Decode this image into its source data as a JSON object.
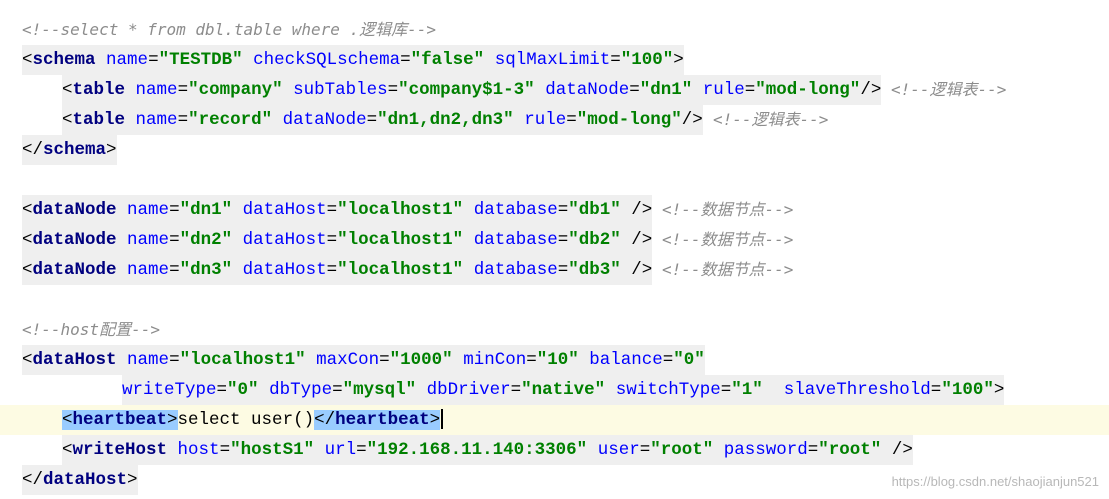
{
  "lines": [
    {
      "id": "l1",
      "tokens": [
        {
          "t": "<!--select * from dbl.table where .逻辑库-->",
          "c": "cmt"
        }
      ]
    },
    {
      "id": "l2",
      "tokens": [
        {
          "t": "<",
          "c": "br"
        },
        {
          "t": "schema",
          "c": "tag"
        },
        {
          "t": " "
        },
        {
          "t": "name",
          "c": "attr"
        },
        {
          "t": "=",
          "c": "txt"
        },
        {
          "t": "\"TESTDB\"",
          "c": "val"
        },
        {
          "t": " "
        },
        {
          "t": "checkSQLschema",
          "c": "attr"
        },
        {
          "t": "=",
          "c": "txt"
        },
        {
          "t": "\"false\"",
          "c": "val"
        },
        {
          "t": " "
        },
        {
          "t": "sqlMaxLimit",
          "c": "attr"
        },
        {
          "t": "=",
          "c": "txt"
        },
        {
          "t": "\"100\"",
          "c": "val"
        },
        {
          "t": ">",
          "c": "br"
        }
      ]
    },
    {
      "id": "l3",
      "tokens": [
        {
          "t": "<",
          "c": "br"
        },
        {
          "t": "table",
          "c": "tag"
        },
        {
          "t": " "
        },
        {
          "t": "name",
          "c": "attr"
        },
        {
          "t": "=",
          "c": "txt"
        },
        {
          "t": "\"company\"",
          "c": "val"
        },
        {
          "t": " "
        },
        {
          "t": "subTables",
          "c": "attr"
        },
        {
          "t": "=",
          "c": "txt"
        },
        {
          "t": "\"company$1-3\"",
          "c": "val"
        },
        {
          "t": " "
        },
        {
          "t": "dataNode",
          "c": "attr"
        },
        {
          "t": "=",
          "c": "txt"
        },
        {
          "t": "\"dn1\"",
          "c": "val"
        },
        {
          "t": " "
        },
        {
          "t": "rule",
          "c": "attr"
        },
        {
          "t": "=",
          "c": "txt"
        },
        {
          "t": "\"mod-long\"",
          "c": "val"
        },
        {
          "t": "/>",
          "c": "br"
        }
      ],
      "comment": "<!--逻辑表-->"
    },
    {
      "id": "l4",
      "tokens": [
        {
          "t": "<",
          "c": "br"
        },
        {
          "t": "table",
          "c": "tag"
        },
        {
          "t": " "
        },
        {
          "t": "name",
          "c": "attr"
        },
        {
          "t": "=",
          "c": "txt"
        },
        {
          "t": "\"record\"",
          "c": "val"
        },
        {
          "t": " "
        },
        {
          "t": "dataNode",
          "c": "attr"
        },
        {
          "t": "=",
          "c": "txt"
        },
        {
          "t": "\"dn1,dn2,dn3\"",
          "c": "val"
        },
        {
          "t": " "
        },
        {
          "t": "rule",
          "c": "attr"
        },
        {
          "t": "=",
          "c": "txt"
        },
        {
          "t": "\"mod-long\"",
          "c": "val"
        },
        {
          "t": "/>",
          "c": "br"
        }
      ],
      "comment": "<!--逻辑表-->"
    },
    {
      "id": "l5",
      "tokens": [
        {
          "t": "</",
          "c": "br"
        },
        {
          "t": "schema",
          "c": "tag"
        },
        {
          "t": ">",
          "c": "br"
        }
      ]
    },
    {
      "id": "l6",
      "tokens": []
    },
    {
      "id": "l7",
      "tokens": [
        {
          "t": "<",
          "c": "br"
        },
        {
          "t": "dataNode",
          "c": "tag"
        },
        {
          "t": " "
        },
        {
          "t": "name",
          "c": "attr"
        },
        {
          "t": "=",
          "c": "txt"
        },
        {
          "t": "\"dn1\"",
          "c": "val"
        },
        {
          "t": " "
        },
        {
          "t": "dataHost",
          "c": "attr"
        },
        {
          "t": "=",
          "c": "txt"
        },
        {
          "t": "\"localhost1\"",
          "c": "val"
        },
        {
          "t": " "
        },
        {
          "t": "database",
          "c": "attr"
        },
        {
          "t": "=",
          "c": "txt"
        },
        {
          "t": "\"db1\"",
          "c": "val"
        },
        {
          "t": " "
        },
        {
          "t": "/>",
          "c": "br"
        }
      ],
      "comment": "<!--数据节点-->"
    },
    {
      "id": "l8",
      "tokens": [
        {
          "t": "<",
          "c": "br"
        },
        {
          "t": "dataNode",
          "c": "tag"
        },
        {
          "t": " "
        },
        {
          "t": "name",
          "c": "attr"
        },
        {
          "t": "=",
          "c": "txt"
        },
        {
          "t": "\"dn2\"",
          "c": "val"
        },
        {
          "t": " "
        },
        {
          "t": "dataHost",
          "c": "attr"
        },
        {
          "t": "=",
          "c": "txt"
        },
        {
          "t": "\"localhost1\"",
          "c": "val"
        },
        {
          "t": " "
        },
        {
          "t": "database",
          "c": "attr"
        },
        {
          "t": "=",
          "c": "txt"
        },
        {
          "t": "\"db2\"",
          "c": "val"
        },
        {
          "t": " "
        },
        {
          "t": "/>",
          "c": "br"
        }
      ],
      "comment": "<!--数据节点-->"
    },
    {
      "id": "l9",
      "tokens": [
        {
          "t": "<",
          "c": "br"
        },
        {
          "t": "dataNode",
          "c": "tag"
        },
        {
          "t": " "
        },
        {
          "t": "name",
          "c": "attr"
        },
        {
          "t": "=",
          "c": "txt"
        },
        {
          "t": "\"dn3\"",
          "c": "val"
        },
        {
          "t": " "
        },
        {
          "t": "dataHost",
          "c": "attr"
        },
        {
          "t": "=",
          "c": "txt"
        },
        {
          "t": "\"localhost1\"",
          "c": "val"
        },
        {
          "t": " "
        },
        {
          "t": "database",
          "c": "attr"
        },
        {
          "t": "=",
          "c": "txt"
        },
        {
          "t": "\"db3\"",
          "c": "val"
        },
        {
          "t": " "
        },
        {
          "t": "/>",
          "c": "br"
        }
      ],
      "comment": "<!--数据节点-->"
    },
    {
      "id": "l10",
      "tokens": []
    },
    {
      "id": "l11",
      "tokens": [
        {
          "t": "<!--host配置-->",
          "c": "cmt"
        }
      ]
    },
    {
      "id": "l12",
      "tokens": [
        {
          "t": "<",
          "c": "br"
        },
        {
          "t": "dataHost",
          "c": "tag"
        },
        {
          "t": " "
        },
        {
          "t": "name",
          "c": "attr"
        },
        {
          "t": "=",
          "c": "txt"
        },
        {
          "t": "\"localhost1\"",
          "c": "val"
        },
        {
          "t": " "
        },
        {
          "t": "maxCon",
          "c": "attr"
        },
        {
          "t": "=",
          "c": "txt"
        },
        {
          "t": "\"1000\"",
          "c": "val"
        },
        {
          "t": " "
        },
        {
          "t": "minCon",
          "c": "attr"
        },
        {
          "t": "=",
          "c": "txt"
        },
        {
          "t": "\"10\"",
          "c": "val"
        },
        {
          "t": " "
        },
        {
          "t": "balance",
          "c": "attr"
        },
        {
          "t": "=",
          "c": "txt"
        },
        {
          "t": "\"0\"",
          "c": "val"
        }
      ]
    },
    {
      "id": "l13",
      "tokens": [
        {
          "t": "writeType",
          "c": "attr"
        },
        {
          "t": "=",
          "c": "txt"
        },
        {
          "t": "\"0\"",
          "c": "val"
        },
        {
          "t": " "
        },
        {
          "t": "dbType",
          "c": "attr"
        },
        {
          "t": "=",
          "c": "txt"
        },
        {
          "t": "\"mysql\"",
          "c": "val"
        },
        {
          "t": " "
        },
        {
          "t": "dbDriver",
          "c": "attr"
        },
        {
          "t": "=",
          "c": "txt"
        },
        {
          "t": "\"native\"",
          "c": "val"
        },
        {
          "t": " "
        },
        {
          "t": "switchType",
          "c": "attr"
        },
        {
          "t": "=",
          "c": "txt"
        },
        {
          "t": "\"1\"",
          "c": "val"
        },
        {
          "t": "  "
        },
        {
          "t": "slaveThreshold",
          "c": "attr"
        },
        {
          "t": "=",
          "c": "txt"
        },
        {
          "t": "\"100\"",
          "c": "val"
        },
        {
          "t": ">",
          "c": "br"
        }
      ]
    },
    {
      "id": "l14",
      "current": true,
      "tokens": [
        {
          "t": "<",
          "c": "br",
          "m": 1
        },
        {
          "t": "heartbeat",
          "c": "tag",
          "m": 1
        },
        {
          "t": ">",
          "c": "br",
          "m": 1
        },
        {
          "t": "select user()",
          "c": "txt"
        },
        {
          "t": "</",
          "c": "br",
          "m": 1
        },
        {
          "t": "heartbeat",
          "c": "tag",
          "m": 1
        },
        {
          "t": ">",
          "c": "br",
          "m": 1
        }
      ]
    },
    {
      "id": "l15",
      "tokens": [
        {
          "t": "<",
          "c": "br"
        },
        {
          "t": "writeHost",
          "c": "tag"
        },
        {
          "t": " "
        },
        {
          "t": "host",
          "c": "attr"
        },
        {
          "t": "=",
          "c": "txt"
        },
        {
          "t": "\"hostS1\"",
          "c": "val"
        },
        {
          "t": " "
        },
        {
          "t": "url",
          "c": "attr"
        },
        {
          "t": "=",
          "c": "txt"
        },
        {
          "t": "\"192.168.11.140:3306\"",
          "c": "val"
        },
        {
          "t": " "
        },
        {
          "t": "user",
          "c": "attr"
        },
        {
          "t": "=",
          "c": "txt"
        },
        {
          "t": "\"root\"",
          "c": "val"
        },
        {
          "t": " "
        },
        {
          "t": "password",
          "c": "attr"
        },
        {
          "t": "=",
          "c": "txt"
        },
        {
          "t": "\"root\"",
          "c": "val"
        },
        {
          "t": " "
        },
        {
          "t": "/>",
          "c": "br"
        }
      ]
    },
    {
      "id": "l16",
      "tokens": [
        {
          "t": "</",
          "c": "br"
        },
        {
          "t": "dataHost",
          "c": "tag"
        },
        {
          "t": ">",
          "c": "br"
        }
      ]
    }
  ],
  "watermark": "https://blog.csdn.net/shaojianjun521"
}
